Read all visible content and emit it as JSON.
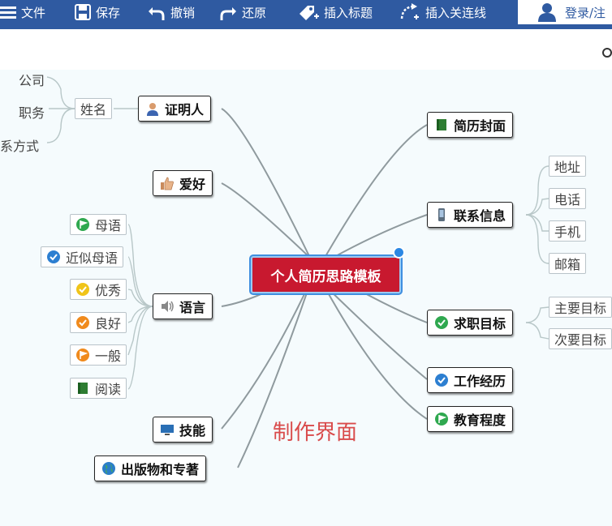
{
  "toolbar": {
    "file_label": "文件",
    "save_label": "保存",
    "undo_label": "撤销",
    "redo_label": "还原",
    "insert_title_label": "插入标题",
    "insert_link_label": "插入关连线",
    "login_label": "登录/注"
  },
  "mindmap": {
    "center": "个人简历思路模板",
    "left": {
      "referee": "证明人",
      "referee_children": {
        "name": "姓名",
        "company": "公司",
        "position": "职务",
        "contact": "系方式"
      },
      "hobby": "爱好",
      "language": "语言",
      "language_children": [
        "母语",
        "近似母语",
        "优秀",
        "良好",
        "一般",
        "阅读"
      ],
      "skills": "技能",
      "publications": "出版物和专著"
    },
    "right": {
      "cover": "简历封面",
      "contact_info": "联系信息",
      "contact_children": [
        "地址",
        "电话",
        "手机",
        "邮箱"
      ],
      "objective": "求职目标",
      "objective_children": [
        "主要目标",
        "次要目标"
      ],
      "experience": "工作经历",
      "education": "教育程度"
    }
  },
  "watermark": "制作界面",
  "colors": {
    "toolbar": "#2f5aa1",
    "center_node": "#c8192f",
    "canvas": "#f5fbfd",
    "watermark": "#d94b4b"
  }
}
